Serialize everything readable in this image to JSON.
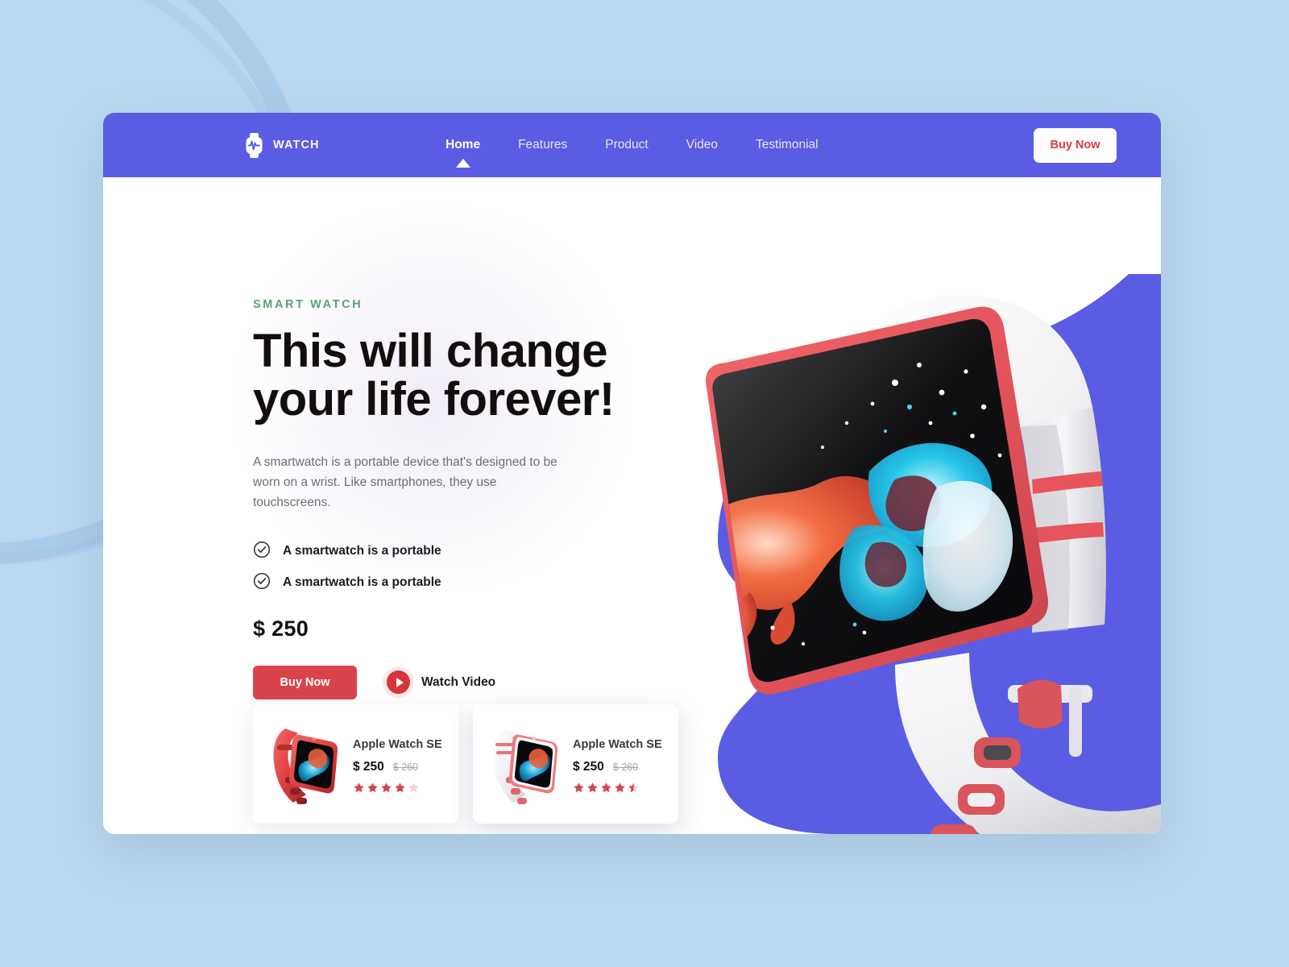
{
  "theme": {
    "page_bg": "#b9d8ef",
    "header_bg": "#5b5ce4",
    "accent_red": "#d9444b",
    "accent_green": "#56a372",
    "blob_purple": "#5b5ce4"
  },
  "header": {
    "brand": {
      "icon": "watch-pulse-icon",
      "label": "WATCH"
    },
    "nav": [
      {
        "label": "Home",
        "active": true
      },
      {
        "label": "Features",
        "active": false
      },
      {
        "label": "Product",
        "active": false
      },
      {
        "label": "Video",
        "active": false
      },
      {
        "label": "Testimonial",
        "active": false
      }
    ],
    "cta_label": "Buy Now"
  },
  "hero": {
    "eyebrow": "SMART WATCH",
    "headline_line1": "This will change",
    "headline_line2": "your life forever!",
    "paragraph": "A smartwatch is a portable device that's designed to be worn on a wrist. Like smartphones, they use touchscreens.",
    "features": [
      {
        "icon": "check-circle-icon",
        "label": "A smartwatch is a portable"
      },
      {
        "icon": "check-circle-icon",
        "label": "A smartwatch is a portable"
      }
    ],
    "price": "$ 250",
    "buy_label": "Buy Now",
    "video_label": "Watch Video",
    "video_icon": "play-circle-icon",
    "image_alt": "white-smartwatch-with-red-accents-paint-splash-screen"
  },
  "cards": [
    {
      "image_alt": "red-apple-watch-se",
      "title": "Apple Watch SE",
      "price": "$ 250",
      "old_price": "$ 260",
      "rating": 4,
      "rating_max": 5
    },
    {
      "image_alt": "white-apple-watch-se",
      "title": "Apple Watch SE",
      "price": "$ 250",
      "old_price": "$ 260",
      "rating": 4.5,
      "rating_max": 5
    }
  ]
}
